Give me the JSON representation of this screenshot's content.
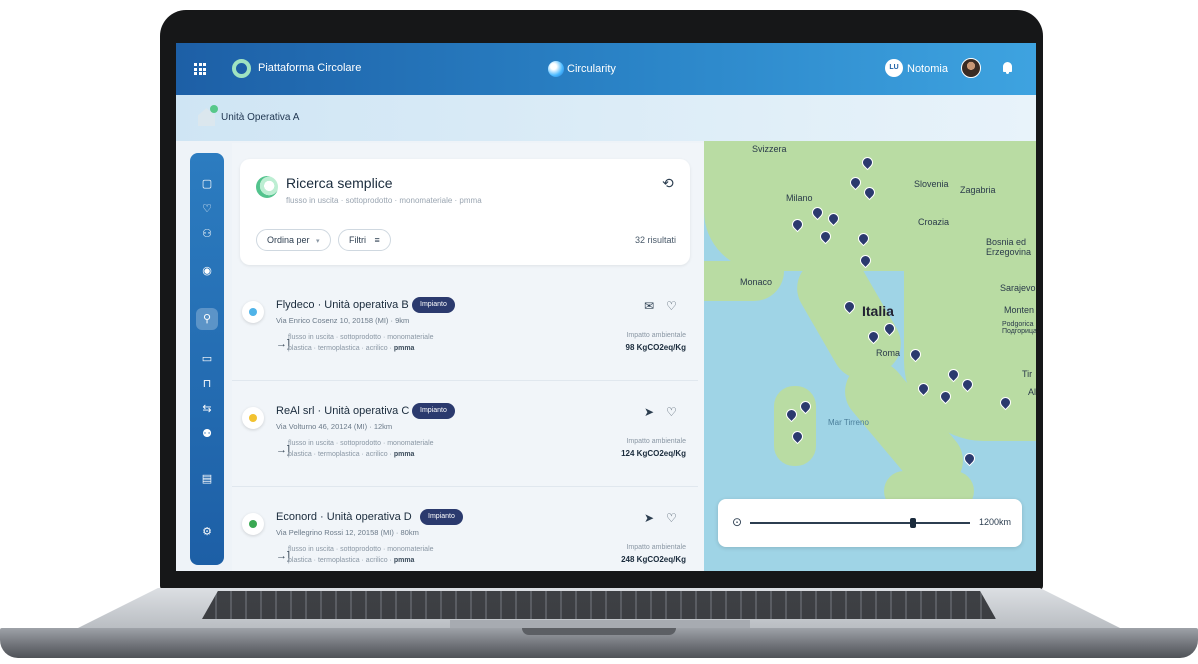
{
  "topbar": {
    "brand": "Piattaforma Circolare",
    "center_brand": "Circularity",
    "org_initials": "LU",
    "org_name": "Notomia"
  },
  "unit": {
    "label": "Unità Operativa A"
  },
  "search": {
    "title": "Ricerca semplice",
    "subtitle": "flusso in uscita · sottoprodotto · monomateriale · pmma",
    "sort_label": "Ordina per",
    "filters_label": "Filtri",
    "results_count": "32 risultati"
  },
  "results": [
    {
      "title": "Flydeco · Unità operativa B",
      "badge": "Impianto",
      "address": "Via Enrico Cosenz 10, 20158 (MI) · 9km",
      "line1": "flusso in uscita · sottoprodotto · monomateriale",
      "line2_prefix": "plastica · termoplastica · acrilico · ",
      "line2_bold": "pmma",
      "impact_label": "Impatto ambientale",
      "impact_value": "98 KgCO2eq/Kg",
      "logo_color": "#4fb3e8"
    },
    {
      "title": "ReAl srl · Unità operativa C",
      "badge": "Impianto",
      "address": "Via Volturno 46, 20124 (MI) · 12km",
      "line1": "flusso in uscita · sottoprodotto · monomateriale",
      "line2_prefix": "plastica · termoplastica · acrilico · ",
      "line2_bold": "pmma",
      "impact_label": "Impatto ambientale",
      "impact_value": "124 KgCO2eq/Kg",
      "logo_color": "#f2c230"
    },
    {
      "title": "Econord · Unità operativa D",
      "badge": "Impianto",
      "address": "Via Pellegrino Rossi 12, 20158 (MI) · 80km",
      "line1": "flusso in uscita · sottoprodotto · monomateriale",
      "line2_prefix": "plastica · termoplastica · acrilico · ",
      "line2_bold": "pmma",
      "impact_label": "Impatto ambientale",
      "impact_value": "248 KgCO2eq/Kg",
      "logo_color": "#3aa852"
    }
  ],
  "map": {
    "labels": {
      "switzerland": "Svizzera",
      "slovenia": "Slovenia",
      "zagreb": "Zagabria",
      "milan": "Milano",
      "croatia": "Croazia",
      "bosnia": "Bosnia ed Erzegovina",
      "monaco": "Monaco",
      "sarajevo": "Sarajevo",
      "italy": "Italia",
      "montenegro": "Monten",
      "podgorica": "Podgorica Подгорица",
      "rome": "Roma",
      "tir": "Tir",
      "al": "Al",
      "tyrrhenian": "Mar Tirreno"
    },
    "distance": "1200km"
  },
  "colors": {
    "primary": "#1d5fa6",
    "badge": "#2b3a6e",
    "accent_green": "#53c38d"
  }
}
